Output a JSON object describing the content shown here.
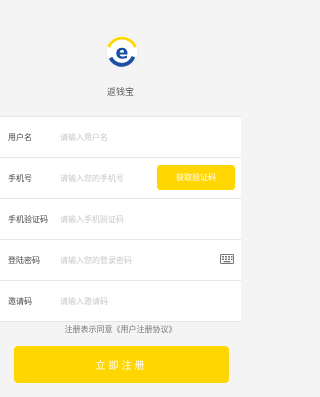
{
  "app": {
    "name": "返钱宝"
  },
  "form": {
    "username": {
      "label": "用户名",
      "placeholder": "请输入用户名"
    },
    "phone": {
      "label": "手机号",
      "placeholder": "请输入您的手机号",
      "code_button": "获取验证码"
    },
    "sms_code": {
      "label": "手机验证码",
      "placeholder": "请输入手机验证码"
    },
    "password": {
      "label": "登陆密码",
      "placeholder": "请输入您的登录密码",
      "icon": "keyboard-icon"
    },
    "invite": {
      "label": "邀请码",
      "placeholder": "请输入邀请码"
    }
  },
  "agreement": "注册表示同意《用户注册协议》",
  "submit_label": "立即注册",
  "colors": {
    "accent": "#ffd600",
    "logo_blue": "#1a4fa3"
  }
}
